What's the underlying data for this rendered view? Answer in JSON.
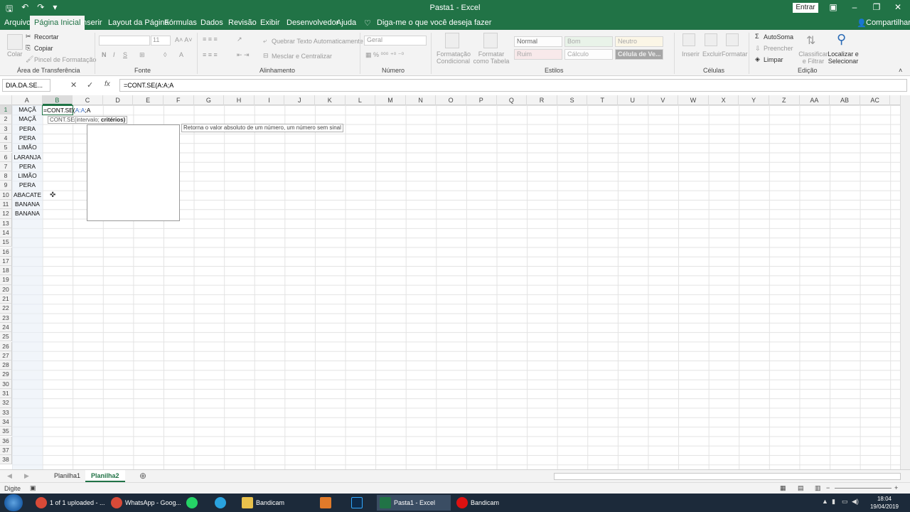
{
  "window": {
    "title": "Pasta1 - Excel",
    "entrar": "Entrar"
  },
  "tabs": [
    "Arquivo",
    "Página Inicial",
    "Inserir",
    "Layout da Página",
    "Fórmulas",
    "Dados",
    "Revisão",
    "Exibir",
    "Desenvolvedor",
    "Ajuda"
  ],
  "active_tab": "Página Inicial",
  "tell_me": "Diga-me o que você deseja fazer",
  "share": "Compartilhar",
  "ribbon": {
    "clipboard": {
      "label": "Área de Transferência",
      "colar": "Colar",
      "recortar": "Recortar",
      "copiar": "Copiar",
      "pincel": "Pincel de Formatação"
    },
    "font": {
      "label": "Fonte",
      "size": "11",
      "bold": "N",
      "italic": "I",
      "underline": "S"
    },
    "alignment": {
      "label": "Alinhamento",
      "wrap": "Quebrar Texto Automaticamente",
      "merge": "Mesclar e Centralizar"
    },
    "number": {
      "label": "Número",
      "format": "Geral"
    },
    "styles": {
      "label": "Estilos",
      "cond_format": "Formatação Condicional",
      "format_table": "Formatar como Tabela",
      "cells": [
        "Normal",
        "Bom",
        "Neutro",
        "Ruim",
        "Cálculo",
        "Célula de Ve..."
      ]
    },
    "cells": {
      "label": "Células",
      "inserir": "Inserir",
      "excluir": "Excluir",
      "formatar": "Formatar"
    },
    "editing": {
      "label": "Edição",
      "autosoma": "AutoSoma",
      "preencher": "Preencher",
      "limpar": "Limpar",
      "classificar": "Classificar e Filtrar",
      "localizar": "Localizar e Selecionar"
    }
  },
  "formula_bar": {
    "name_box": "DIA.DA.SE...",
    "formula": "=CONT.SE(A:A;A",
    "fx": "fx"
  },
  "columns": [
    "A",
    "B",
    "C",
    "D",
    "E",
    "F",
    "G",
    "H",
    "I",
    "J",
    "K",
    "L",
    "M",
    "N",
    "O",
    "P",
    "Q",
    "R",
    "S",
    "T",
    "U",
    "V",
    "W",
    "X",
    "Y",
    "Z",
    "AA",
    "AB",
    "AC"
  ],
  "rows": [
    "1",
    "2",
    "3",
    "4",
    "5",
    "6",
    "7",
    "8",
    "9",
    "10",
    "11",
    "12",
    "13",
    "14",
    "15",
    "16",
    "17",
    "18",
    "19",
    "20",
    "21",
    "22",
    "23",
    "24",
    "25",
    "26",
    "27",
    "28",
    "29",
    "30",
    "31",
    "32",
    "33",
    "34",
    "35",
    "36",
    "37",
    "38"
  ],
  "column_a_values": [
    "MAÇÃ",
    "MAÇÃ",
    "PERA",
    "PERA",
    "LIMÃO",
    "LARANJA",
    "PERA",
    "LIMÃO",
    "PERA",
    "ABACATE",
    "BANANA",
    "BANANA"
  ],
  "active_cell": {
    "prefix": "=CONT.SE(",
    "ref": "A:A",
    "suffix": ";A"
  },
  "function_tip": {
    "fn": "CONT.SE(intervalo; ",
    "arg": "critérios)"
  },
  "autocomplete_tip": "Retorna o valor absoluto de um número, um número sem sinal",
  "sheets": [
    "Planilha1",
    "Planilha2"
  ],
  "active_sheet": "Planilha2",
  "status": "Digite",
  "taskbar": {
    "items": [
      "1 of 1 uploaded - ...",
      "WhatsApp - Goog...",
      "",
      "",
      "Bandicam",
      "",
      "",
      "Pasta1 - Excel",
      "Bandicam"
    ],
    "time": "18:04",
    "date": "19/04/2019"
  }
}
